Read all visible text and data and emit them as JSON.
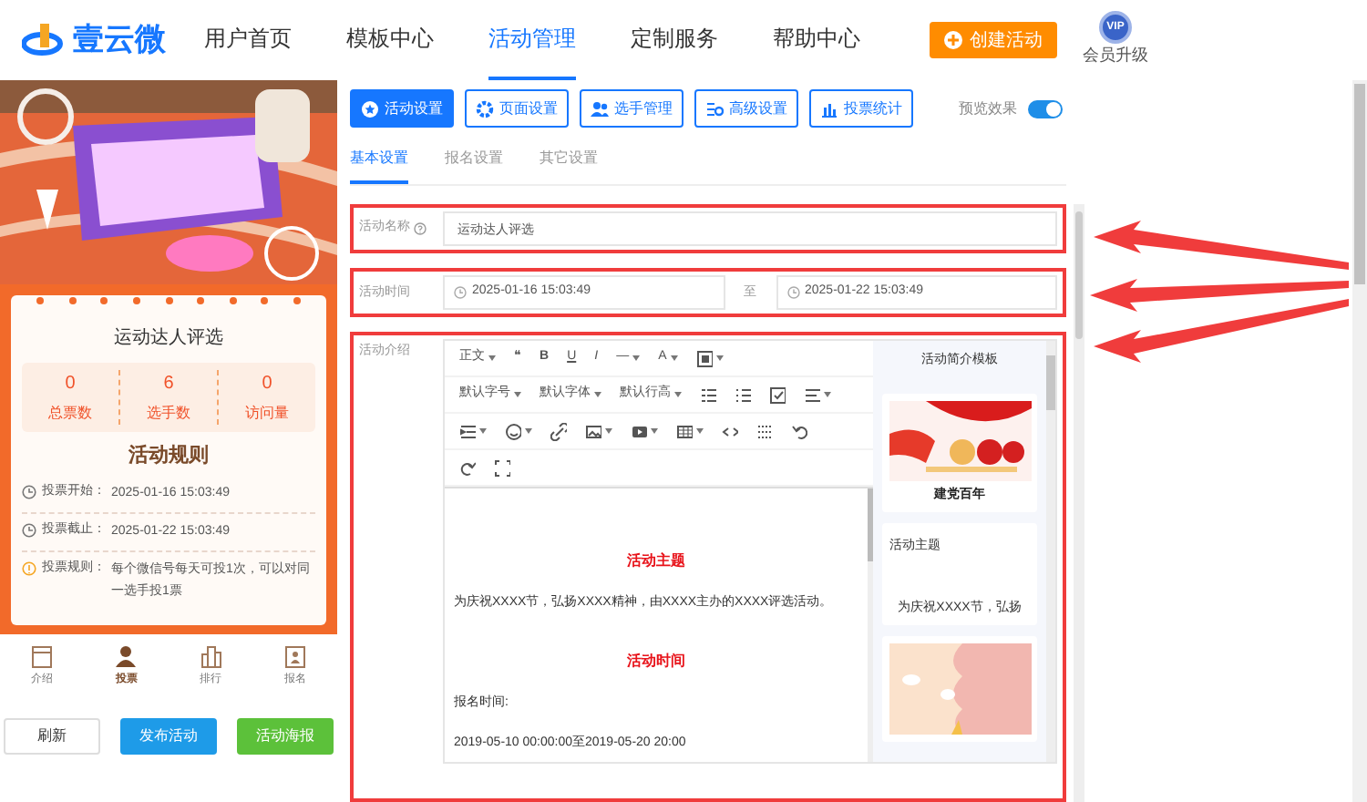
{
  "header": {
    "logo": "壹云微",
    "nav": [
      {
        "label": "用户首页",
        "selected": false
      },
      {
        "label": "模板中心",
        "selected": false
      },
      {
        "label": "活动管理",
        "selected": true
      },
      {
        "label": "定制服务",
        "selected": false
      },
      {
        "label": "帮助中心",
        "selected": false
      }
    ],
    "create_button": "创建活动",
    "vip": {
      "badge": "VIP",
      "label": "会员升级"
    }
  },
  "preview": {
    "poster": {
      "kind": "picture"
    },
    "card": {
      "title": "运动达人评选",
      "stats": [
        {
          "value": "0",
          "label": "总票数"
        },
        {
          "value": "6",
          "label": "选手数"
        },
        {
          "value": "0",
          "label": "访问量"
        }
      ],
      "rules_title": "活动规则",
      "rules": [
        {
          "kind": "clock",
          "label": "投票开始：",
          "text": "2025-01-16 15:03:49"
        },
        {
          "kind": "clock",
          "label": "投票截止：",
          "text": "2025-01-22 15:03:49"
        },
        {
          "kind": "info",
          "label": "投票规则：",
          "text": "每个微信号每天可投1次，可以对同一选手投1票"
        }
      ]
    },
    "bottom_nav": [
      {
        "label": "介绍",
        "selected": false
      },
      {
        "label": "投票",
        "selected": true
      },
      {
        "label": "排行",
        "selected": false
      },
      {
        "label": "报名",
        "selected": false
      }
    ],
    "buttons": [
      {
        "label": "刷新",
        "kind": "plain"
      },
      {
        "label": "发布活动",
        "kind": "primary"
      },
      {
        "label": "活动海报",
        "kind": "success"
      }
    ]
  },
  "settings_tabs": [
    {
      "label": "活动设置",
      "selected": true
    },
    {
      "label": "页面设置",
      "selected": false
    },
    {
      "label": "选手管理",
      "selected": false
    },
    {
      "label": "高级设置",
      "selected": false
    },
    {
      "label": "投票统计",
      "selected": false
    }
  ],
  "preview_toggle": {
    "label": "预览效果",
    "on": true
  },
  "sub_tabs": [
    {
      "label": "基本设置",
      "selected": true
    },
    {
      "label": "报名设置",
      "selected": false
    },
    {
      "label": "其它设置",
      "selected": false
    }
  ],
  "form": {
    "name": {
      "label": "活动名称",
      "value": "运动达人评选"
    },
    "time": {
      "label": "活动时间",
      "start": "2025-01-16 15:03:49",
      "separator": "至",
      "end": "2025-01-22 15:03:49"
    },
    "intro": {
      "label": "活动介绍",
      "toolbar": [
        [
          {
            "kind": "dropdown",
            "label": "正文"
          },
          {
            "kind": "text",
            "label": "❝"
          },
          {
            "kind": "bold",
            "label": "B"
          },
          {
            "kind": "underline",
            "label": "U"
          },
          {
            "kind": "italic",
            "label": "I"
          },
          {
            "kind": "dropdown",
            "label": "—"
          },
          {
            "kind": "dropdown",
            "label": "A"
          },
          {
            "kind": "menu"
          }
        ],
        [
          {
            "kind": "dropdown",
            "label": "默认字号"
          },
          {
            "kind": "dropdown",
            "label": "默认字体"
          },
          {
            "kind": "dropdown",
            "label": "默认行高"
          },
          {
            "kind": "icon"
          },
          {
            "kind": "icon"
          },
          {
            "kind": "icon"
          },
          {
            "kind": "menu"
          }
        ],
        [
          {
            "kind": "menu"
          },
          {
            "kind": "menu"
          },
          {
            "kind": "icon"
          },
          {
            "kind": "menu"
          },
          {
            "kind": "menu"
          },
          {
            "kind": "menu"
          },
          {
            "kind": "icon"
          },
          {
            "kind": "icon"
          },
          {
            "kind": "icon"
          }
        ],
        [
          {
            "kind": "icon"
          },
          {
            "kind": "icon"
          }
        ]
      ],
      "content": [
        {
          "kind": "heading",
          "text": "活动主题"
        },
        {
          "kind": "para",
          "text": "为庆祝XXXX节，弘扬XXXX精神，由XXXX主办的XXXX评选活动。"
        },
        {
          "kind": "heading",
          "text": "活动时间"
        },
        {
          "kind": "para",
          "text": "报名时间:"
        },
        {
          "kind": "para",
          "text": "2019-05-10 00:00:00至2019-05-20 20:00"
        }
      ],
      "templates": {
        "title": "活动简介模板",
        "items": [
          {
            "kind": "picture",
            "caption": "建党百年"
          },
          {
            "kind": "text",
            "title": "活动主题",
            "caption": "为庆祝XXXX节，弘扬"
          },
          {
            "kind": "picture"
          }
        ]
      }
    }
  }
}
